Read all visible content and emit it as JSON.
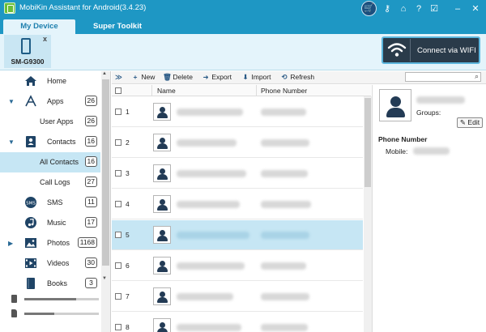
{
  "app": {
    "title": "MobiKin Assistant for Android(3.4.23)"
  },
  "titlebar_icons": [
    "cart-icon",
    "key-icon",
    "home-icon",
    "help-icon",
    "feedback-icon",
    "minimize-icon",
    "close-icon"
  ],
  "titlebar_glyphs": {
    "key": "⚷",
    "home": "⌂",
    "help": "?",
    "feedback": "☑",
    "minimize": "–",
    "close": "✕",
    "cart": "🛒"
  },
  "tabs": [
    {
      "label": "My Device",
      "active": true
    },
    {
      "label": "Super Toolkit",
      "active": false
    }
  ],
  "device": {
    "name": "SM-G9300",
    "close": "x"
  },
  "wifi_button": {
    "label": "Connect via WIFI"
  },
  "sidebar": {
    "items": [
      {
        "label": "Home",
        "icon": "home-icon",
        "count": "",
        "expander": ""
      },
      {
        "label": "Apps",
        "icon": "apps-icon",
        "count": "26",
        "expander": "▼"
      },
      {
        "label": "User Apps",
        "icon": "",
        "count": "26",
        "expander": ""
      },
      {
        "label": "Contacts",
        "icon": "contacts-icon",
        "count": "16",
        "expander": "▼"
      },
      {
        "label": "All Contacts",
        "icon": "",
        "count": "16",
        "expander": "",
        "selected": true
      },
      {
        "label": "Call Logs",
        "icon": "",
        "count": "27",
        "expander": ""
      },
      {
        "label": "SMS",
        "icon": "sms-icon",
        "count": "11",
        "expander": ""
      },
      {
        "label": "Music",
        "icon": "music-icon",
        "count": "17",
        "expander": ""
      },
      {
        "label": "Photos",
        "icon": "photos-icon",
        "count": "1168",
        "expander": "▶"
      },
      {
        "label": "Videos",
        "icon": "videos-icon",
        "count": "30",
        "expander": ""
      },
      {
        "label": "Books",
        "icon": "books-icon",
        "count": "3",
        "expander": ""
      }
    ],
    "storage": [
      {
        "icon": "phone-storage-icon",
        "fill": 0.7
      },
      {
        "icon": "sd-card-icon",
        "fill": 0.4
      }
    ]
  },
  "toolbar": {
    "expand": "≫",
    "new": {
      "icon": "+",
      "label": "New"
    },
    "delete": {
      "icon": "🗑",
      "label": "Delete"
    },
    "export": {
      "icon": "➜",
      "label": "Export"
    },
    "import": {
      "icon": "⬇",
      "label": "Import"
    },
    "refresh": {
      "icon": "⟲",
      "label": "Refresh"
    },
    "search_icon": "⌕"
  },
  "list": {
    "columns": {
      "name": "Name",
      "phone": "Phone Number"
    },
    "rows": [
      {
        "num": "1",
        "selected": false
      },
      {
        "num": "2",
        "selected": false
      },
      {
        "num": "3",
        "selected": false
      },
      {
        "num": "4",
        "selected": false
      },
      {
        "num": "5",
        "selected": true
      },
      {
        "num": "6",
        "selected": false
      },
      {
        "num": "7",
        "selected": false
      },
      {
        "num": "8",
        "selected": false
      }
    ]
  },
  "detail": {
    "groups_label": "Groups:",
    "edit_label": "Edit",
    "edit_icon": "✎",
    "phone_title": "Phone Number",
    "mobile_label": "Mobile:"
  },
  "colors": {
    "accent": "#1e97c4",
    "selected_row": "#c6e6f4",
    "wifi_bg": "#2a3b4a"
  }
}
